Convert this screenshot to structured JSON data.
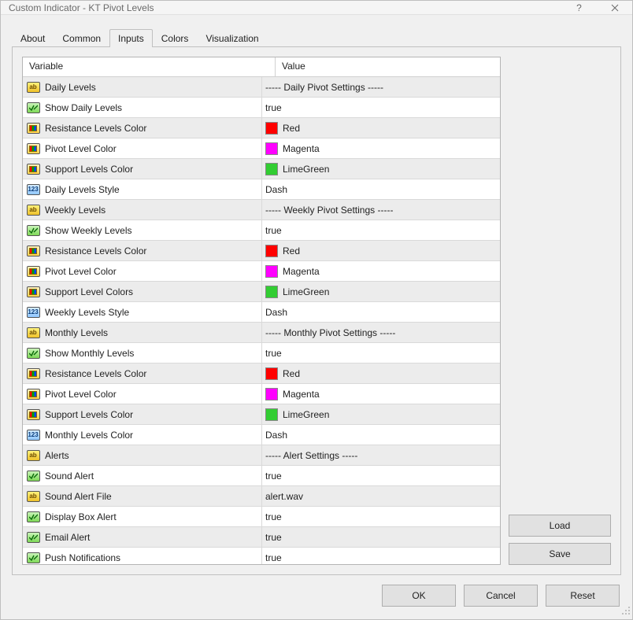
{
  "window": {
    "title": "Custom Indicator - KT Pivot Levels"
  },
  "tabs": [
    {
      "label": "About"
    },
    {
      "label": "Common"
    },
    {
      "label": "Inputs"
    },
    {
      "label": "Colors"
    },
    {
      "label": "Visualization"
    }
  ],
  "active_tab_index": 2,
  "grid": {
    "columns": {
      "variable": "Variable",
      "value": "Value"
    },
    "rows": [
      {
        "type": "ab",
        "name": "Daily Levels",
        "value": "----- Daily Pivot Settings -----"
      },
      {
        "type": "bool",
        "name": "Show Daily Levels",
        "value": "true"
      },
      {
        "type": "color",
        "name": "Resistance Levels Color",
        "value": "Red",
        "swatch": "red"
      },
      {
        "type": "color",
        "name": "Pivot Level Color",
        "value": "Magenta",
        "swatch": "magenta"
      },
      {
        "type": "color",
        "name": "Support Levels Color",
        "value": "LimeGreen",
        "swatch": "lime"
      },
      {
        "type": "num",
        "name": "Daily Levels Style",
        "value": "Dash"
      },
      {
        "type": "ab",
        "name": "Weekly Levels",
        "value": "----- Weekly Pivot Settings -----"
      },
      {
        "type": "bool",
        "name": "Show Weekly Levels",
        "value": "true"
      },
      {
        "type": "color",
        "name": "Resistance Levels Color",
        "value": "Red",
        "swatch": "red"
      },
      {
        "type": "color",
        "name": "Pivot Level Color",
        "value": "Magenta",
        "swatch": "magenta"
      },
      {
        "type": "color",
        "name": "Support Level Colors",
        "value": "LimeGreen",
        "swatch": "lime"
      },
      {
        "type": "num",
        "name": "Weekly Levels Style",
        "value": "Dash"
      },
      {
        "type": "ab",
        "name": "Monthly Levels",
        "value": "----- Monthly Pivot Settings -----"
      },
      {
        "type": "bool",
        "name": "Show Monthly Levels",
        "value": "true"
      },
      {
        "type": "color",
        "name": "Resistance Levels Color",
        "value": "Red",
        "swatch": "red"
      },
      {
        "type": "color",
        "name": "Pivot Level Color",
        "value": "Magenta",
        "swatch": "magenta"
      },
      {
        "type": "color",
        "name": "Support Levels Color",
        "value": "LimeGreen",
        "swatch": "lime"
      },
      {
        "type": "num",
        "name": "Monthly Levels Color",
        "value": "Dash"
      },
      {
        "type": "ab",
        "name": "Alerts",
        "value": "----- Alert Settings -----"
      },
      {
        "type": "bool",
        "name": "Sound Alert",
        "value": "true"
      },
      {
        "type": "ab",
        "name": "Sound Alert File",
        "value": "alert.wav"
      },
      {
        "type": "bool",
        "name": "Display Box Alert",
        "value": "true"
      },
      {
        "type": "bool",
        "name": "Email Alert",
        "value": "true"
      },
      {
        "type": "bool",
        "name": "Push Notifications",
        "value": "true"
      }
    ]
  },
  "buttons": {
    "load": "Load",
    "save": "Save",
    "ok": "OK",
    "cancel": "Cancel",
    "reset": "Reset"
  },
  "colors": {
    "red": "#ff0000",
    "magenta": "#ff00ff",
    "lime": "#32cd32"
  }
}
